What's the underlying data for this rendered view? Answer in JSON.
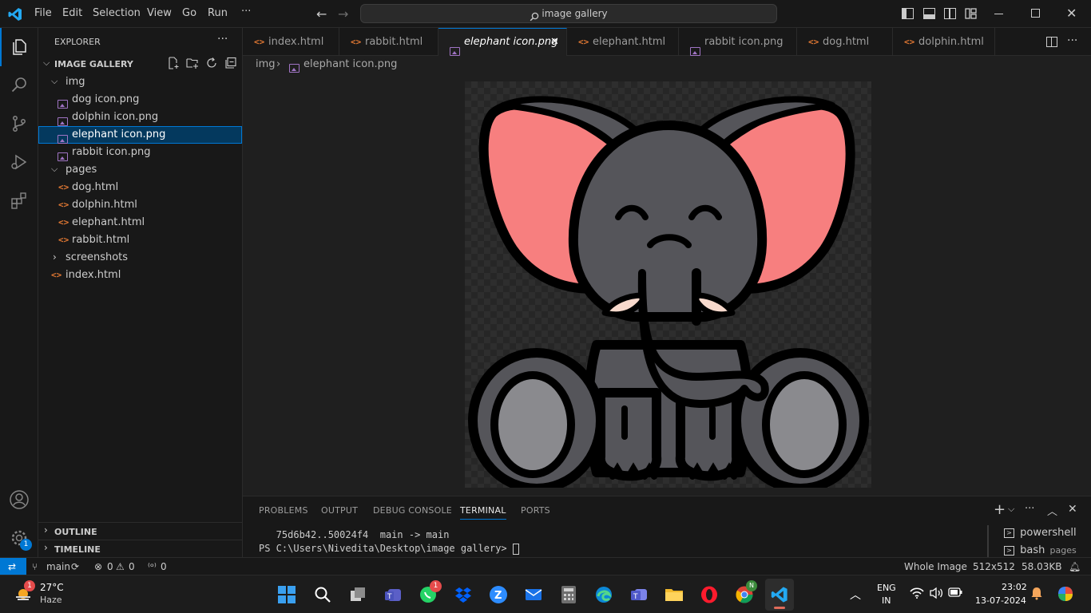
{
  "titlebar": {
    "menu": [
      "File",
      "Edit",
      "Selection",
      "View",
      "Go",
      "Run",
      "···"
    ],
    "command_center": "image gallery"
  },
  "explorer": {
    "header": "EXPLORER",
    "project": "IMAGE GALLERY",
    "tree": [
      {
        "label": "img",
        "kind": "folder-open"
      },
      {
        "label": "dog icon.png",
        "kind": "image"
      },
      {
        "label": "dolphin icon.png",
        "kind": "image"
      },
      {
        "label": "elephant icon.png",
        "kind": "image"
      },
      {
        "label": "rabbit icon.png",
        "kind": "image"
      },
      {
        "label": "pages",
        "kind": "folder-open"
      },
      {
        "label": "dog.html",
        "kind": "html"
      },
      {
        "label": "dolphin.html",
        "kind": "html"
      },
      {
        "label": "elephant.html",
        "kind": "html"
      },
      {
        "label": "rabbit.html",
        "kind": "html"
      },
      {
        "label": "screenshots",
        "kind": "folder-closed"
      },
      {
        "label": "index.html",
        "kind": "html"
      }
    ],
    "outline": "OUTLINE",
    "timeline": "TIMELINE"
  },
  "tabs": [
    {
      "label": "index.html",
      "kind": "html"
    },
    {
      "label": "rabbit.html",
      "kind": "html"
    },
    {
      "label": "elephant icon.png",
      "kind": "image",
      "active": true
    },
    {
      "label": "elephant.html",
      "kind": "html"
    },
    {
      "label": "rabbit icon.png",
      "kind": "image"
    },
    {
      "label": "dog.html",
      "kind": "html"
    },
    {
      "label": "dolphin.html",
      "kind": "html"
    }
  ],
  "breadcrumb": {
    "folder": "img",
    "file": "elephant icon.png"
  },
  "panel": {
    "tabs": [
      "PROBLEMS",
      "OUTPUT",
      "DEBUG CONSOLE",
      "TERMINAL",
      "PORTS"
    ],
    "active_tab": "TERMINAL",
    "terminal_lines": [
      "   75d6b42..50024f4  main -> main",
      "PS C:\\Users\\Nivedita\\Desktop\\image gallery> "
    ],
    "terminals": [
      {
        "label": "powershell",
        "sub": ""
      },
      {
        "label": "bash",
        "sub": "pages"
      }
    ]
  },
  "statusbar": {
    "branch": "main",
    "errors": "0",
    "warnings": "0",
    "ports": "0",
    "zoom_mode": "Whole Image",
    "dimensions": "512x512",
    "size": "58.03KB",
    "accounts_badge": "1"
  },
  "taskbar": {
    "weather_temp": "27°C",
    "weather_desc": "Haze",
    "weather_badge": "1",
    "whatsapp_badge": "1",
    "chrome_badge": "N",
    "lang_top": "ENG",
    "lang_bottom": "IN",
    "time": "23:02",
    "date": "13-07-2024"
  },
  "colors": {
    "accent": "#0078d4",
    "elephant_body": "#55555a",
    "elephant_ear": "#f77f7f",
    "elephant_foot": "#8a8a8e",
    "tusk": "#f7d9cc"
  }
}
